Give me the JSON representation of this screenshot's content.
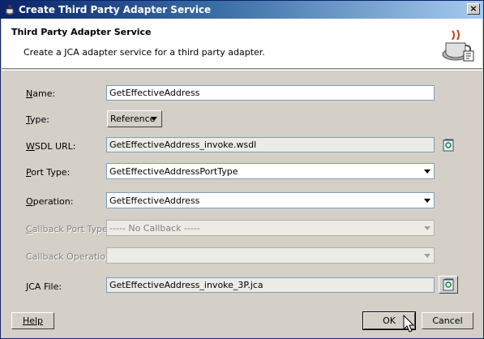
{
  "window": {
    "title": "Create Third Party Adapter Service",
    "close_label": "×"
  },
  "header": {
    "title": "Third Party Adapter Service",
    "description": "Create a JCA adapter service for a third party adapter."
  },
  "form": {
    "name": {
      "label_key": "N",
      "label_rest": "ame:",
      "value": "GetEffectiveAddress"
    },
    "type": {
      "label_key": "T",
      "label_rest": "ype:",
      "value": "Reference"
    },
    "wsdl_url": {
      "label_key": "W",
      "label_rest": "SDL URL:",
      "value": "GetEffectiveAddress_invoke.wsdl"
    },
    "port_type": {
      "label_key": "P",
      "label_rest": "ort Type:",
      "value": "GetEffectiveAddressPortType"
    },
    "operation": {
      "label_key": "O",
      "label_rest": "peration:",
      "value": "GetEffectiveAddress"
    },
    "callback_port_type": {
      "label_key": "C",
      "label_rest": "allback Port Type:",
      "value": "----- No Callback -----"
    },
    "callback_operation": {
      "label_key": "",
      "label_rest": "Callback Operation:",
      "value": ""
    },
    "jca_file": {
      "label_key": "J",
      "label_rest": "CA File:",
      "value": "GetEffectiveAddress_invoke_3P.jca"
    }
  },
  "buttons": {
    "help": "Help",
    "ok": "OK",
    "cancel": "Cancel"
  },
  "icons": {
    "app": "coffee-cup-icon",
    "wizard": "coffee-cup-adapter-icon",
    "wsdl_browse": "wsdl-browse-icon",
    "jca_browse": "jca-browse-icon",
    "cursor": "mouse-pointer-icon"
  },
  "colors": {
    "titlebar": "#0a246a",
    "dialog_bg": "#d4d0c8",
    "field_border": "#7f9db9"
  }
}
